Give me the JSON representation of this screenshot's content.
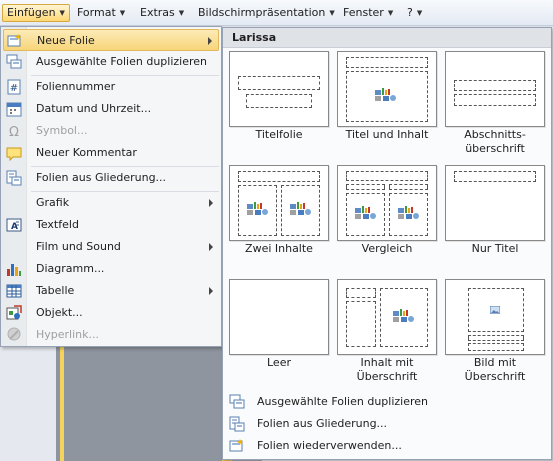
{
  "menubar": {
    "items": [
      {
        "label": "Einfügen",
        "active": true
      },
      {
        "label": "Format"
      },
      {
        "label": "Extras"
      },
      {
        "label": "Bildschirmpräsentation"
      },
      {
        "label": "Fenster"
      },
      {
        "label": "?"
      }
    ]
  },
  "menu": {
    "items": [
      {
        "label": "Neue Folie",
        "submenu": true,
        "highlighted": true,
        "icon": "new-slide-icon"
      },
      {
        "label": "Ausgewählte Folien duplizieren",
        "icon": "duplicate-slides-icon"
      },
      {
        "label": "Foliennummer",
        "icon": "slide-number-icon"
      },
      {
        "label": "Datum und Uhrzeit...",
        "icon": "date-time-icon"
      },
      {
        "label": "Symbol...",
        "disabled": true,
        "icon": "omega-icon"
      },
      {
        "label": "Neuer Kommentar",
        "icon": "comment-icon"
      },
      {
        "label": "Folien aus Gliederung...",
        "icon": "slides-from-outline-icon"
      },
      {
        "label": "Grafik",
        "submenu": true
      },
      {
        "label": "Textfeld",
        "icon": "textbox-icon"
      },
      {
        "label": "Film und Sound",
        "submenu": true
      },
      {
        "label": "Diagramm...",
        "icon": "chart-icon"
      },
      {
        "label": "Tabelle",
        "submenu": true,
        "icon": "table-icon"
      },
      {
        "label": "Objekt...",
        "icon": "object-icon"
      },
      {
        "label": "Hyperlink...",
        "disabled": true,
        "icon": "hyperlink-icon"
      }
    ]
  },
  "panel": {
    "header": "Larissa",
    "layouts": [
      {
        "label": "Titelfolie"
      },
      {
        "label": "Titel und Inhalt"
      },
      {
        "label": "Abschnitts-\nüberschrift"
      },
      {
        "label": "Zwei Inhalte"
      },
      {
        "label": "Vergleich"
      },
      {
        "label": "Nur Titel"
      },
      {
        "label": "Leer"
      },
      {
        "label": "Inhalt mit\nÜberschrift"
      },
      {
        "label": "Bild mit\nÜberschrift"
      }
    ],
    "actions": [
      {
        "label": "Ausgewählte Folien duplizieren",
        "icon": "duplicate-slides-icon"
      },
      {
        "label": "Folien aus Gliederung...",
        "icon": "slides-from-outline-icon"
      },
      {
        "label": "Folien wiederverwenden...",
        "icon": "reuse-slides-icon"
      }
    ]
  },
  "colors": {
    "highlight": "#f8d578",
    "panel_header": "#dfe3e8",
    "menu_border": "#97a3b5"
  }
}
